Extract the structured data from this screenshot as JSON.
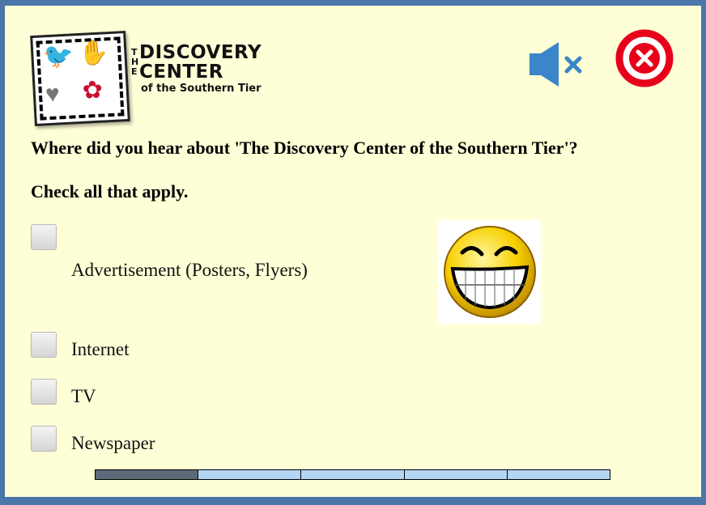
{
  "logo": {
    "the": "THE",
    "line1": "DISCOVERY",
    "line2": "CENTER",
    "subtitle": "of the Southern Tier"
  },
  "controls": {
    "mute_icon": "speaker-muted-icon",
    "close_icon": "close-circle-icon"
  },
  "question": {
    "text": "Where did you hear about 'The Discovery Center of the Southern Tier'?",
    "instruction": "Check all that apply."
  },
  "options": [
    {
      "label": "Advertisement (Posters, Flyers)",
      "checked": false
    },
    {
      "label": "Internet",
      "checked": false
    },
    {
      "label": "TV",
      "checked": false
    },
    {
      "label": "Newspaper",
      "checked": false
    }
  ],
  "image": {
    "icon": "grinning-smiley-icon"
  },
  "progress": {
    "total_steps": 5,
    "completed_steps": 1
  },
  "colors": {
    "background": "#ffffd7",
    "frame": "#4a76a8",
    "mute_icon": "#3a86c8",
    "close_icon": "#e8001a",
    "progress_done": "#5e6a78",
    "progress_todo": "#b3d6f5"
  }
}
